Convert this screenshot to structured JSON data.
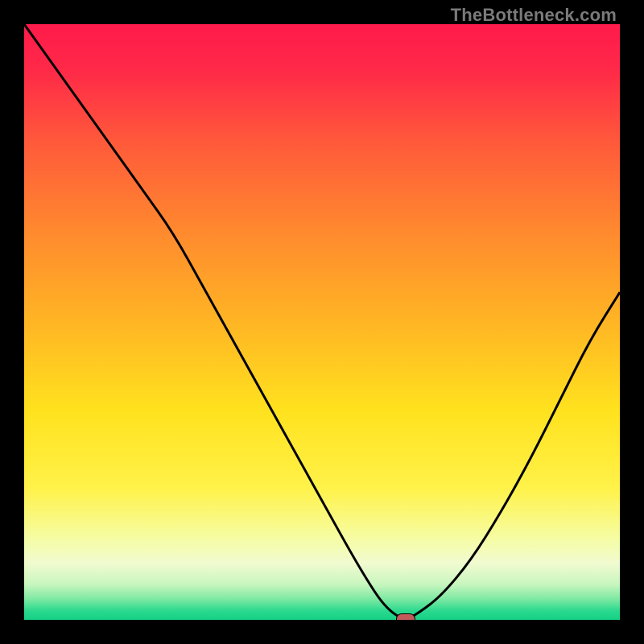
{
  "watermark": "TheBottleneck.com",
  "colors": {
    "frame": "#000000",
    "curve": "#000000",
    "marker_fill": "#c35a5a",
    "marker_stroke": "#000000",
    "gradient_stops": [
      {
        "offset": 0.0,
        "color": "#ff1a4b"
      },
      {
        "offset": 0.08,
        "color": "#ff2a48"
      },
      {
        "offset": 0.2,
        "color": "#ff5a3a"
      },
      {
        "offset": 0.35,
        "color": "#ff8a2e"
      },
      {
        "offset": 0.5,
        "color": "#ffb524"
      },
      {
        "offset": 0.65,
        "color": "#ffe21e"
      },
      {
        "offset": 0.78,
        "color": "#fff24a"
      },
      {
        "offset": 0.86,
        "color": "#f6fca0"
      },
      {
        "offset": 0.905,
        "color": "#f1fbd0"
      },
      {
        "offset": 0.94,
        "color": "#c9f6bf"
      },
      {
        "offset": 0.965,
        "color": "#7ee9a3"
      },
      {
        "offset": 0.985,
        "color": "#2ad98e"
      },
      {
        "offset": 1.0,
        "color": "#15d085"
      }
    ]
  },
  "chart_data": {
    "type": "line",
    "title": "",
    "xlabel": "",
    "ylabel": "",
    "xlim": [
      0,
      100
    ],
    "ylim": [
      0,
      100
    ],
    "series": [
      {
        "name": "curve",
        "x": [
          0,
          5,
          10,
          15,
          20,
          25,
          30,
          35,
          40,
          45,
          50,
          55,
          58,
          60,
          62,
          64,
          66,
          70,
          75,
          80,
          85,
          90,
          95,
          100
        ],
        "y": [
          100,
          93,
          86,
          79,
          72,
          65,
          56,
          47,
          38,
          29,
          20,
          11,
          6,
          3,
          1,
          0,
          1,
          4,
          10,
          18,
          27,
          37,
          47,
          55
        ]
      }
    ],
    "flat_segment": {
      "x_start": 55,
      "x_end": 64,
      "y": 0
    },
    "marker": {
      "x": 64,
      "y": 0
    },
    "notes": "Values are read from the rendered figure by visual estimation against a 0–100 axis in both directions; the y colour gradient runs from red (high) through yellow to green (low)."
  }
}
